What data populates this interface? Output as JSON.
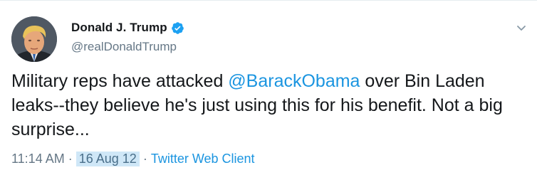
{
  "tweet": {
    "author_name": "Donald J. Trump",
    "author_handle": "@realDonaldTrump",
    "verified": true,
    "text_before_mention": "Military reps have attacked ",
    "mention": "@BarackObama",
    "text_after_mention": " over Bin Laden leaks--they believe he's just using this for his benefit. Not a big surprise...",
    "time": "11:14 AM",
    "separator": "·",
    "date": "16 Aug 12",
    "source": "Twitter Web Client"
  },
  "icons": {
    "verified": "verified-badge-icon",
    "menu": "chevron-down-icon"
  },
  "colors": {
    "link": "#1b95e0",
    "secondary_text": "#657786",
    "date_highlight": "#cfe7f7"
  }
}
